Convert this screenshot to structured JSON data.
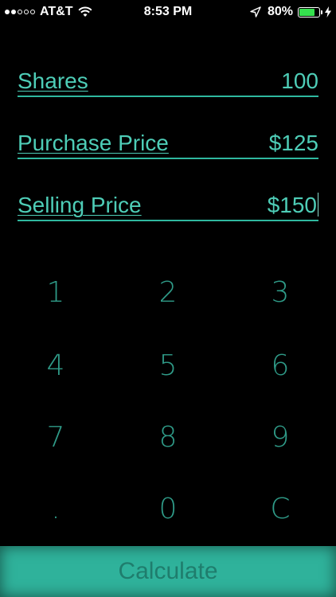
{
  "status_bar": {
    "signal_full": 2,
    "signal_empty": 3,
    "carrier": "AT&T",
    "time": "8:53 PM",
    "battery_percent": "80%",
    "battery_level": 0.8,
    "icons": [
      "wifi-icon",
      "location-icon",
      "battery-icon",
      "charging-bolt-icon"
    ]
  },
  "fields": {
    "shares": {
      "label": "Shares",
      "value": "100"
    },
    "purchase_price": {
      "label": "Purchase Price",
      "value": "$125"
    },
    "selling_price": {
      "label": "Selling Price",
      "value": "$150"
    }
  },
  "keypad": {
    "keys": [
      "1",
      "2",
      "3",
      "4",
      "5",
      "6",
      "7",
      "8",
      "9",
      ".",
      "0",
      "C"
    ]
  },
  "calculate_label": "Calculate",
  "colors": {
    "background": "#000000",
    "accent": "#4ecdb7",
    "underline": "#2fb89f",
    "keypad_text": "#2f9b88",
    "button_bg": "#2fb29b",
    "button_text": "#1f7d6d",
    "battery_fill": "#35e04e"
  }
}
